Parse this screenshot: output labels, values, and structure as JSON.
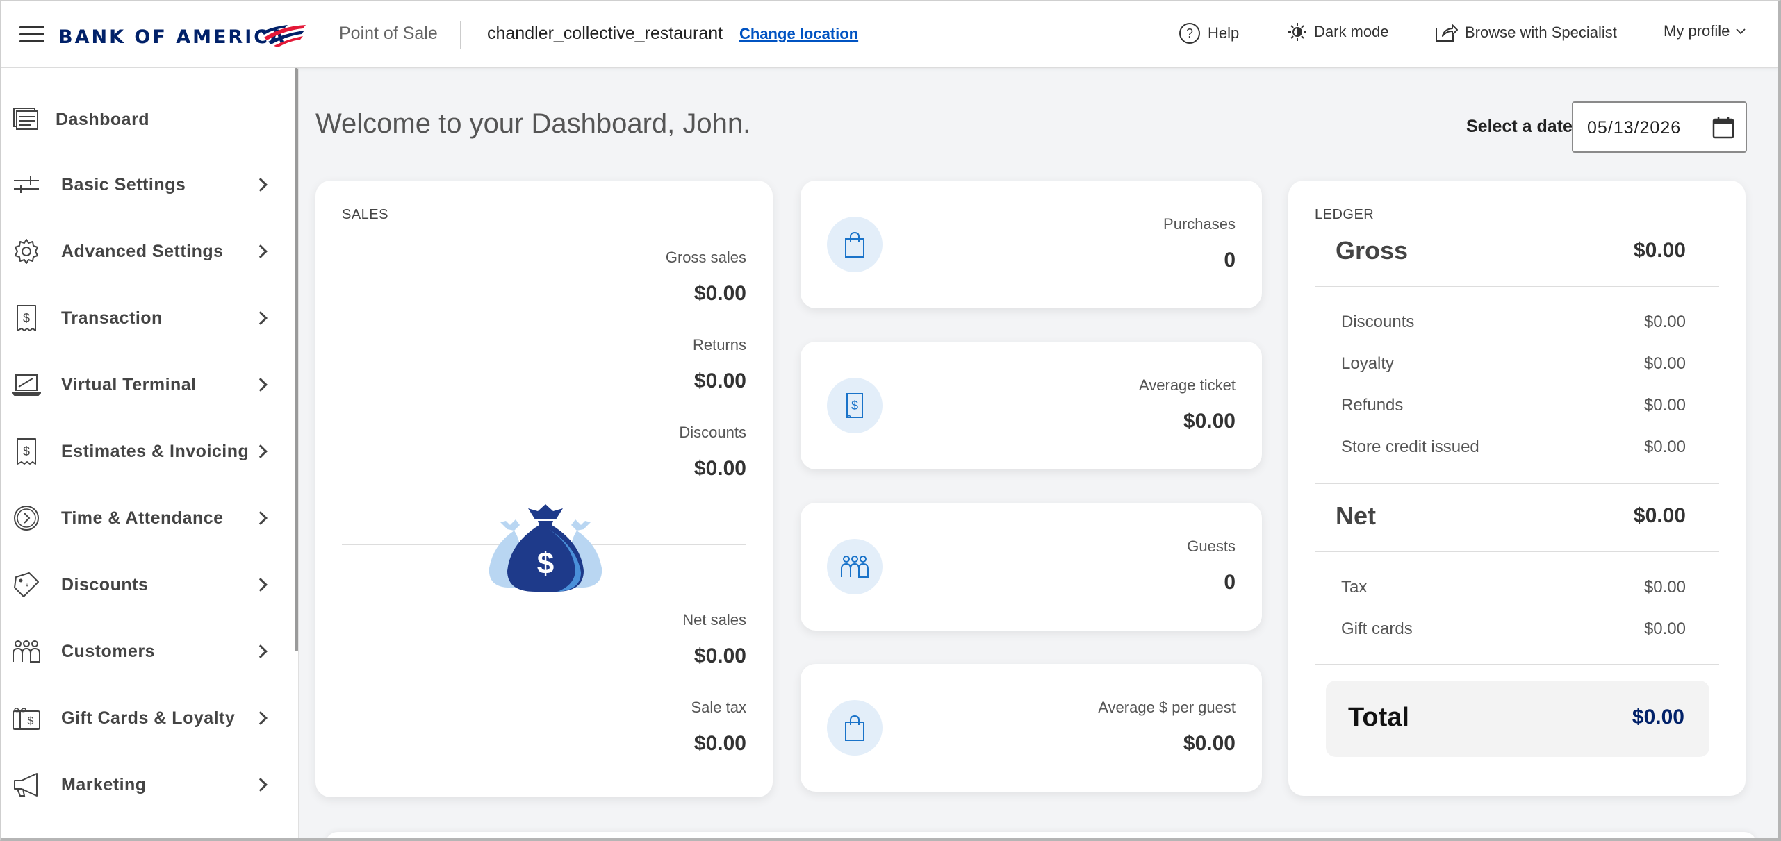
{
  "header": {
    "brand": "BANK OF AMERICA",
    "product": "Point of Sale",
    "location": "chandler_collective_restaurant",
    "change_location": "Change location",
    "help": "Help",
    "dark_mode": "Dark mode",
    "browse_specialist": "Browse with Specialist",
    "my_profile": "My profile"
  },
  "sidebar": {
    "items": [
      {
        "label": "Dashboard",
        "icon": "dashboard-icon"
      },
      {
        "label": "Basic Settings",
        "icon": "sliders-icon"
      },
      {
        "label": "Advanced Settings",
        "icon": "gear-icon"
      },
      {
        "label": "Transaction",
        "icon": "dollar-doc-icon"
      },
      {
        "label": "Virtual Terminal",
        "icon": "laptop-icon"
      },
      {
        "label": "Estimates & Invoicing",
        "icon": "invoice-icon"
      },
      {
        "label": "Time & Attendance",
        "icon": "clock-icon"
      },
      {
        "label": "Discounts",
        "icon": "tag-icon"
      },
      {
        "label": "Customers",
        "icon": "people-icon"
      },
      {
        "label": "Gift Cards & Loyalty",
        "icon": "gift-card-icon"
      },
      {
        "label": "Marketing",
        "icon": "megaphone-icon"
      }
    ]
  },
  "main": {
    "welcome": "Welcome to your Dashboard, John.",
    "date_label": "Select a date",
    "date_value": "05/13/2026"
  },
  "sales": {
    "title": "SALES",
    "gross_label": "Gross sales",
    "gross_value": "$0.00",
    "returns_label": "Returns",
    "returns_value": "$0.00",
    "discounts_label": "Discounts",
    "discounts_value": "$0.00",
    "net_label": "Net sales",
    "net_value": "$0.00",
    "tax_label": "Sale tax",
    "tax_value": "$0.00"
  },
  "stats": {
    "purchases_label": "Purchases",
    "purchases_value": "0",
    "avg_ticket_label": "Average ticket",
    "avg_ticket_value": "$0.00",
    "guests_label": "Guests",
    "guests_value": "0",
    "avg_guest_label": "Average $ per guest",
    "avg_guest_value": "$0.00"
  },
  "ledger": {
    "title": "LEDGER",
    "gross_label": "Gross",
    "gross_value": "$0.00",
    "discounts_label": "Discounts",
    "discounts_value": "$0.00",
    "loyalty_label": "Loyalty",
    "loyalty_value": "$0.00",
    "refunds_label": "Refunds",
    "refunds_value": "$0.00",
    "store_credit_label": "Store credit issued",
    "store_credit_value": "$0.00",
    "net_label": "Net",
    "net_value": "$0.00",
    "tax_label": "Tax",
    "tax_value": "$0.00",
    "gift_cards_label": "Gift cards",
    "gift_cards_value": "$0.00",
    "total_label": "Total",
    "total_value": "$0.00"
  },
  "colors": {
    "brand_navy": "#012169",
    "brand_red": "#e31837",
    "link_blue": "#0053c2",
    "icon_bg": "#e3eef9"
  }
}
